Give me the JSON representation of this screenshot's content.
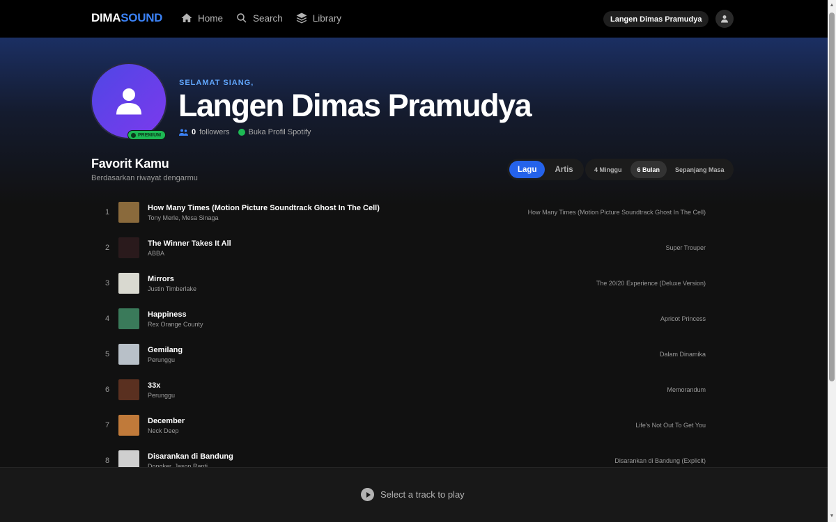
{
  "nav": {
    "logo_part1": "DIMA",
    "logo_part2": "SOUND",
    "links": [
      {
        "label": "Home",
        "icon": "home-icon"
      },
      {
        "label": "Search",
        "icon": "search-icon"
      },
      {
        "label": "Library",
        "icon": "library-icon"
      }
    ],
    "user_pill": "Langen Dimas Pramudya",
    "user_icon": "user-icon"
  },
  "profile": {
    "greeting": "SELAMAT SIANG,",
    "name": "Langen Dimas Pramudya",
    "badge": "PREMIUM",
    "followers_count": "0",
    "followers_label": "followers",
    "spotify_link": "Buka Profil Spotify"
  },
  "favorites": {
    "title": "Favorit Kamu",
    "subtitle": "Berdasarkan riwayat dengarmu",
    "type_tabs": [
      "Lagu",
      "Artis"
    ],
    "type_active": "Lagu",
    "range_tabs": [
      "4 Minggu",
      "6 Bulan",
      "Sepanjang Masa"
    ],
    "range_active": "6 Bulan"
  },
  "tracks": [
    {
      "rank": "1",
      "title": "How Many Times (Motion Picture Soundtrack Ghost In The Cell)",
      "artist": "Tony Merle, Mesa Sinaga",
      "album": "How Many Times (Motion Picture Soundtrack Ghost In The Cell)",
      "cover_color": "#8a6a3c"
    },
    {
      "rank": "2",
      "title": "The Winner Takes It All",
      "artist": "ABBA",
      "album": "Super Trouper",
      "cover_color": "#2a1a1c"
    },
    {
      "rank": "3",
      "title": "Mirrors",
      "artist": "Justin Timberlake",
      "album": "The 20/20 Experience (Deluxe Version)",
      "cover_color": "#d9d9d0"
    },
    {
      "rank": "4",
      "title": "Happiness",
      "artist": "Rex Orange County",
      "album": "Apricot Princess",
      "cover_color": "#3a7a5a"
    },
    {
      "rank": "5",
      "title": "Gemilang",
      "artist": "Perunggu",
      "album": "Dalam Dinamika",
      "cover_color": "#b8c0c8"
    },
    {
      "rank": "6",
      "title": "33x",
      "artist": "Perunggu",
      "album": "Memorandum",
      "cover_color": "#5a3020"
    },
    {
      "rank": "7",
      "title": "December",
      "artist": "Neck Deep",
      "album": "Life's Not Out To Get You",
      "cover_color": "#c07a3a"
    },
    {
      "rank": "8",
      "title": "Disarankan di Bandung",
      "artist": "Dongker, Jason Ranti",
      "album": "Disarankan di Bandung (Explicit)",
      "cover_color": "#cfcfcf"
    }
  ],
  "player": {
    "empty_message": "Select a track to play"
  }
}
